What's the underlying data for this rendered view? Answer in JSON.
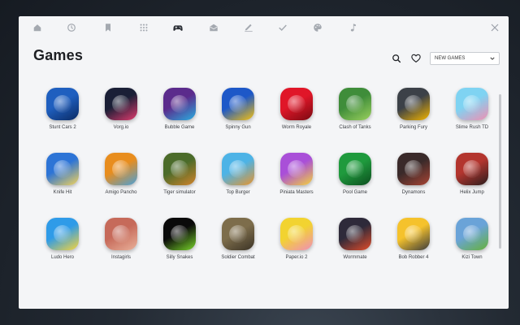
{
  "nav": {
    "items": [
      {
        "icon": "home-icon"
      },
      {
        "icon": "history-icon"
      },
      {
        "icon": "bookmark-icon"
      },
      {
        "icon": "apps-grid-icon"
      },
      {
        "icon": "gamepad-icon",
        "active": true
      },
      {
        "icon": "mail-icon"
      },
      {
        "icon": "pen-icon"
      },
      {
        "icon": "checkmark-icon"
      },
      {
        "icon": "palette-icon"
      },
      {
        "icon": "music-note-icon"
      }
    ],
    "close_icon": "close-icon"
  },
  "page": {
    "title": "Games"
  },
  "tools": {
    "search_icon": "search-icon",
    "favorite_icon": "heart-icon",
    "sort_dropdown": {
      "selected": "NEW GAMES",
      "icon": "chevron-down-icon"
    }
  },
  "games": [
    {
      "name": "Stunt Cars 2",
      "colors": [
        "#1f5fbf",
        "#0b2a63"
      ]
    },
    {
      "name": "Vorg.io",
      "colors": [
        "#1a1f36",
        "#e23b6e"
      ]
    },
    {
      "name": "Bubble Game",
      "colors": [
        "#5b2b8c",
        "#29aee0"
      ]
    },
    {
      "name": "Spinny Gun",
      "colors": [
        "#1d58c8",
        "#f6c10e"
      ]
    },
    {
      "name": "Worm Royale",
      "colors": [
        "#e01628",
        "#7a0a12"
      ]
    },
    {
      "name": "Clash of Tanks",
      "colors": [
        "#3f8d3a",
        "#9bd05e"
      ]
    },
    {
      "name": "Parking Fury",
      "colors": [
        "#3c4148",
        "#f2b400"
      ]
    },
    {
      "name": "Slime Rush TD",
      "colors": [
        "#7fd3f2",
        "#f08fb2"
      ]
    },
    {
      "name": "Knife Hit",
      "colors": [
        "#2d74d6",
        "#f3d35a"
      ]
    },
    {
      "name": "Amigo Pancho",
      "colors": [
        "#e88d1e",
        "#4aa0d8"
      ]
    },
    {
      "name": "Tiger simulator",
      "colors": [
        "#4b6b2a",
        "#d1832b"
      ]
    },
    {
      "name": "Top Burger",
      "colors": [
        "#4db3e6",
        "#e7942e"
      ]
    },
    {
      "name": "Piniata Masters",
      "colors": [
        "#a94fd8",
        "#f4d23c"
      ]
    },
    {
      "name": "Pool Game",
      "colors": [
        "#1f9a3d",
        "#0d4e1f"
      ]
    },
    {
      "name": "Dynamons",
      "colors": [
        "#3a2a2a",
        "#a84434"
      ]
    },
    {
      "name": "Helix Jump",
      "colors": [
        "#b3352e",
        "#2a1e1e"
      ]
    },
    {
      "name": "Ludo Hero",
      "colors": [
        "#2f9be8",
        "#f7d43a"
      ]
    },
    {
      "name": "Instagirls",
      "colors": [
        "#c66a5a",
        "#e9b19a"
      ]
    },
    {
      "name": "Silly Snakes",
      "colors": [
        "#0a0a0a",
        "#78d42a"
      ]
    },
    {
      "name": "Soldier Combat",
      "colors": [
        "#7d6d4b",
        "#3b3326"
      ]
    },
    {
      "name": "Paper.io 2",
      "colors": [
        "#f2d330",
        "#f08fb8"
      ]
    },
    {
      "name": "Wormmate",
      "colors": [
        "#2e2a3a",
        "#e24c2a"
      ]
    },
    {
      "name": "Bob Robber 4",
      "colors": [
        "#f5c22c",
        "#3b3b3b"
      ]
    },
    {
      "name": "Kizi Town",
      "colors": [
        "#6aa3d8",
        "#66b13a"
      ]
    }
  ],
  "colors": {
    "panel_bg": "#f4f5f7",
    "text_dark": "#1d1f23",
    "icon_muted": "#9aa0a8"
  }
}
